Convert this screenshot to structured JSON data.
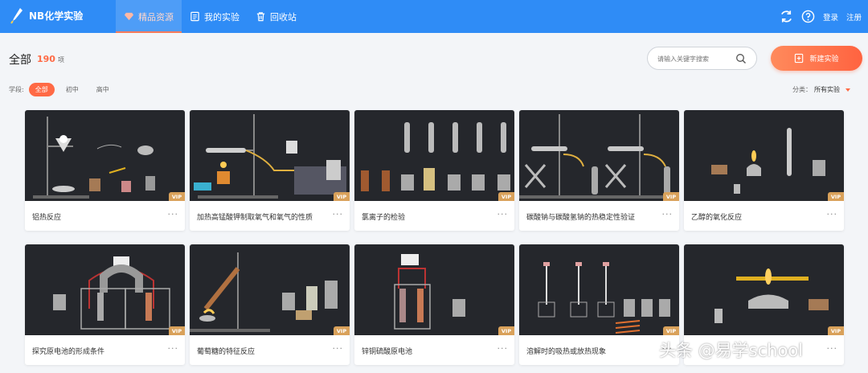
{
  "app": {
    "name": "NB化学实验"
  },
  "nav": [
    {
      "label": "精品资源",
      "icon": "diamond-icon",
      "active": true
    },
    {
      "label": "我的实验",
      "icon": "document-icon",
      "active": false
    },
    {
      "label": "回收站",
      "icon": "trash-icon",
      "active": false
    }
  ],
  "top_right": {
    "login": "登录",
    "register": "注册"
  },
  "header": {
    "title": "全部",
    "count": "190",
    "count_unit": "项"
  },
  "search": {
    "placeholder": "请输入关键字搜索"
  },
  "new_button": {
    "label": "新建实验"
  },
  "filter": {
    "label": "学段:",
    "options": [
      "全部",
      "初中",
      "高中"
    ],
    "selected": "全部"
  },
  "category": {
    "label": "分类：",
    "value": "所有实验"
  },
  "vip_label": "VIP",
  "more_label": "···",
  "cards": [
    {
      "title": "铝热反应"
    },
    {
      "title": "加热高锰酸钾制取氧气和氧气的性质"
    },
    {
      "title": "氯离子的检验"
    },
    {
      "title": "碳酸钠与碳酸氢钠的热稳定性验证"
    },
    {
      "title": "乙醇的氧化反应"
    },
    {
      "title": "探究原电池的形成条件"
    },
    {
      "title": "葡萄糖的特征反应"
    },
    {
      "title": "锌铜硫酸原电池"
    },
    {
      "title": "溶解时的吸热或放热现象"
    },
    {
      "title": ""
    }
  ],
  "watermark": "头条 @易学school",
  "colors": {
    "primary": "#2f8cf6",
    "accent": "#ff6a45",
    "vip": "#d9a15a"
  }
}
